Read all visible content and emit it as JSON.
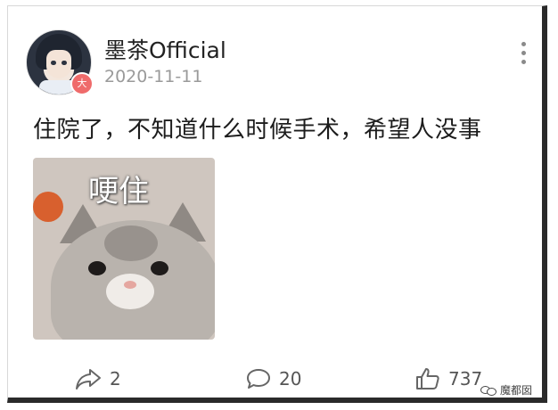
{
  "post": {
    "username": "墨茶Official",
    "date": "2020-11-11",
    "badge_icon": "v-badge-icon",
    "badge_glyph": "大",
    "badge_color": "#ef6b6b",
    "text": "住院了，不知道什么时候手术，希望人没事",
    "image": {
      "caption": "哽住",
      "description_icon": "crying-cat-meme"
    }
  },
  "actions": {
    "share_count": "2",
    "comment_count": "20",
    "like_count": "737"
  },
  "watermark": {
    "text": "魔都囡",
    "icon": "wechat-icon"
  }
}
